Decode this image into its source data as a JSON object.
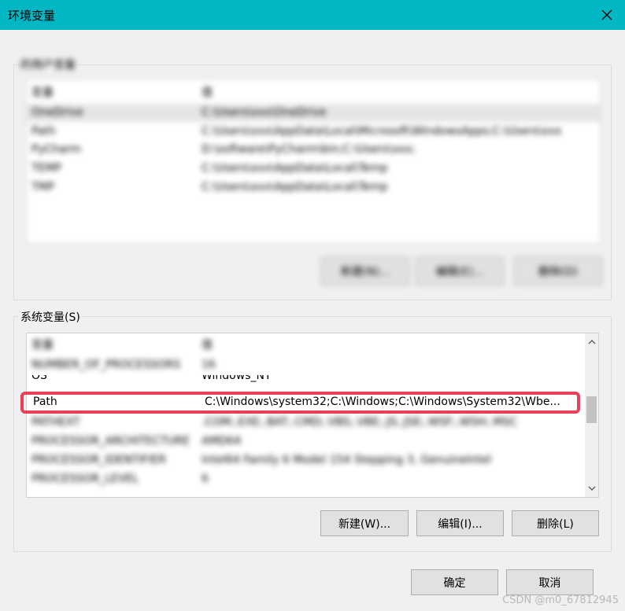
{
  "window": {
    "title": "环境变量",
    "close_icon": "close-icon"
  },
  "user_vars": {
    "label": "的用户变量",
    "headers": {
      "name": "变量",
      "value": "值"
    },
    "rows": [
      {
        "name": "OneDrive",
        "value": "C:\\Users\\xxx\\OneDrive"
      },
      {
        "name": "Path",
        "value": "C:\\Users\\xxx\\AppData\\Local\\Microsoft\\WindowsApps;C:\\Users\\xxx"
      },
      {
        "name": "PyCharm",
        "value": "D:\\software\\PyCharm\\bin;C:\\Users\\xxx;"
      },
      {
        "name": "TEMP",
        "value": "C:\\Users\\xxx\\AppData\\Local\\Temp"
      },
      {
        "name": "TMP",
        "value": "C:\\Users\\xxx\\AppData\\Local\\Temp"
      }
    ],
    "buttons": {
      "new": "新建(N)...",
      "edit": "编辑(E)...",
      "delete": "删除(D)"
    }
  },
  "system_vars": {
    "label": "系统变量(S)",
    "headers": {
      "name": "变量",
      "value": "值"
    },
    "rows": [
      {
        "name": "NUMBER_OF_PROCESSORS",
        "value": "16",
        "blurred": true
      },
      {
        "name": "OS",
        "value": "Windows_NT",
        "blurred": false
      },
      {
        "name": "Path",
        "value": "C:\\Windows\\system32;C:\\Windows;C:\\Windows\\System32\\Wbe...",
        "blurred": false
      },
      {
        "name": "PATHEXT",
        "value": ".COM;.EXE;.BAT;.CMD;.VBS;.VBE;.JS;.JSE;.WSF;.WSH;.MSC",
        "blurred": true
      },
      {
        "name": "PROCESSOR_ARCHITECTURE",
        "value": "AMD64",
        "blurred": true
      },
      {
        "name": "PROCESSOR_IDENTIFIER",
        "value": "Intel64 Family 6 Model 154 Stepping 3, GenuineIntel",
        "blurred": true
      },
      {
        "name": "PROCESSOR_LEVEL",
        "value": "6",
        "blurred": true
      }
    ],
    "buttons": {
      "new": "新建(W)...",
      "edit": "编辑(I)...",
      "delete": "删除(L)"
    }
  },
  "footer": {
    "ok": "确定",
    "cancel": "取消"
  },
  "watermark": "CSDN @m0_67812945",
  "colors": {
    "titlebar": "#00b7c3",
    "highlight": "#e94057",
    "button_bg": "#e1e1e1"
  }
}
